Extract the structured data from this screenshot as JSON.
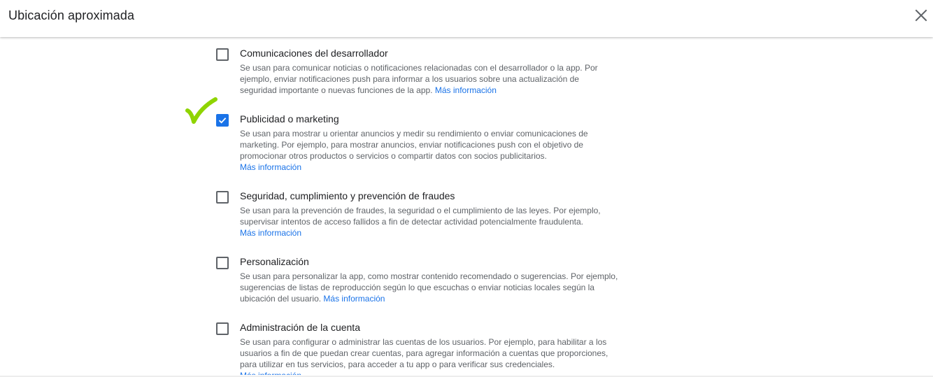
{
  "dialog": {
    "title": "Ubicación aproximada",
    "close_icon": "close-icon"
  },
  "annotation": {
    "icon": "checkmark-annotation-icon",
    "color": "#8fd400"
  },
  "colors": {
    "accent": "#1a73e8",
    "text": "#202124",
    "secondary_text": "#5f6368"
  },
  "purposes": [
    {
      "title": "Comunicaciones del desarrollador",
      "checked": false,
      "desc_lines": [
        "Se usan para comunicar noticias o notificaciones relacionadas con el desarrollador o la app. Por",
        "ejemplo, enviar notificaciones push para informar a los usuarios sobre una actualización de",
        "seguridad importante o nuevas funciones de la app."
      ],
      "more_link": "Más información"
    },
    {
      "title": "Publicidad o marketing",
      "checked": true,
      "desc_lines": [
        "Se usan para mostrar u orientar anuncios y medir su rendimiento o enviar comunicaciones de",
        "marketing. Por ejemplo, para mostrar anuncios, enviar notificaciones push con el objetivo de",
        "promocionar otros productos o servicios o compartir datos con socios publicitarios."
      ],
      "more_link": "Más información"
    },
    {
      "title": "Seguridad, cumplimiento y prevención de fraudes",
      "checked": false,
      "desc_lines": [
        "Se usan para la prevención de fraudes, la seguridad o el cumplimiento de las leyes. Por ejemplo,",
        "supervisar intentos de acceso fallidos a fin de detectar actividad potencialmente fraudulenta."
      ],
      "more_link": "Más información"
    },
    {
      "title": "Personalización",
      "checked": false,
      "desc_lines": [
        "Se usan para personalizar la app, como mostrar contenido recomendado o sugerencias. Por ejemplo,",
        "sugerencias de listas de reproducción según lo que escuchas o enviar noticias locales según la",
        "ubicación del usuario."
      ],
      "more_link": "Más información"
    },
    {
      "title": "Administración de la cuenta",
      "checked": false,
      "desc_lines": [
        "Se usan para configurar o administrar las cuentas de los usuarios. Por ejemplo, para habilitar a los",
        "usuarios a fin de que puedan crear cuentas, para agregar información a cuentas que proporciones,",
        "para utilizar en tus servicios, para acceder a tu app o para verificar sus credenciales."
      ],
      "more_link": "Más información"
    }
  ]
}
